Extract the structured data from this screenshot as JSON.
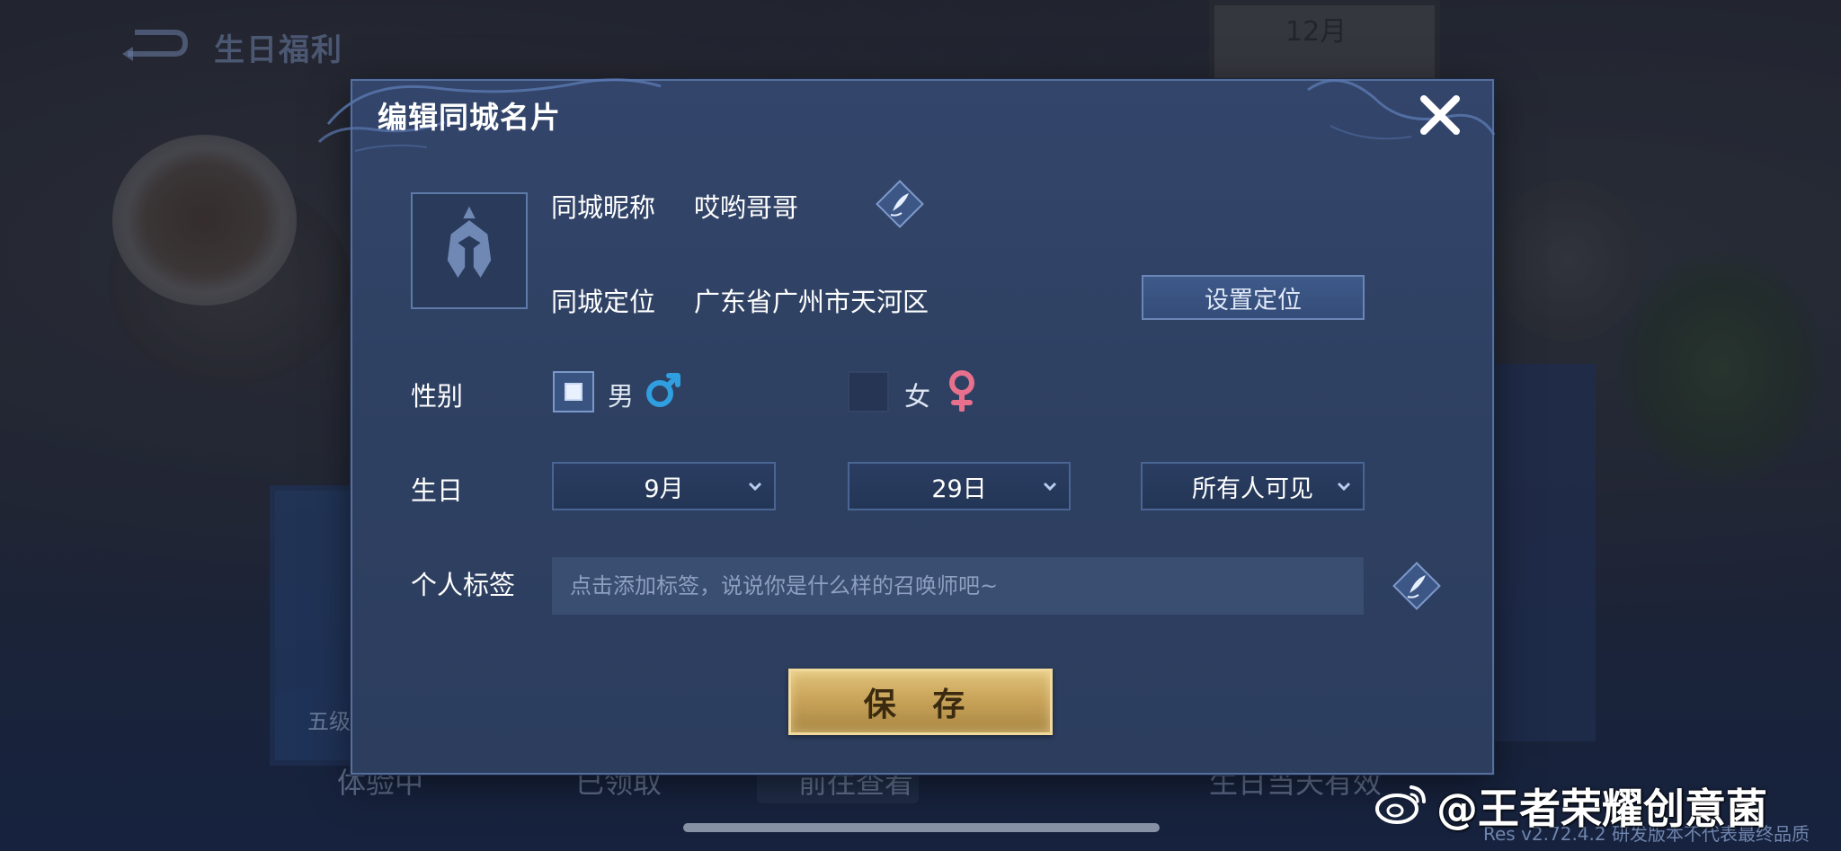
{
  "background": {
    "calendar_text": "12月",
    "top_title": "生日福利",
    "box_label": "五级",
    "bottom_buttons": [
      "体验中",
      "已领取",
      "前往查看",
      "生日当天有效"
    ],
    "version": "Res v2.72.4.2 研发版本不代表最终品质",
    "watermark": "@王者荣耀创意菌"
  },
  "dialog": {
    "title": "编辑同城名片",
    "nickname_label": "同城昵称",
    "nickname_value": "哎哟哥哥",
    "location_label": "同城定位",
    "location_value": "广东省广州市天河区",
    "set_location_button": "设置定位",
    "gender_label": "性别",
    "gender_male": "男",
    "gender_female": "女",
    "gender_selected": "male",
    "birthday_label": "生日",
    "birthday_month": "9月",
    "birthday_day": "29日",
    "visibility": "所有人可见",
    "tag_label": "个人标签",
    "tag_placeholder": "点击添加标签，说说你是什么样的召唤师吧~",
    "save_button": "保 存"
  },
  "colors": {
    "dialog_bg": "#2f4163",
    "dialog_border": "#55709e",
    "male_icon": "#2f9fe0",
    "female_icon": "#e8708c",
    "save_gold": "#c9a45a"
  },
  "icons": [
    "back-arrow-icon",
    "close-icon",
    "helmet-avatar-icon",
    "edit-quill-icon",
    "male-symbol-icon",
    "female-symbol-icon",
    "chevron-down-icon",
    "weibo-icon"
  ]
}
